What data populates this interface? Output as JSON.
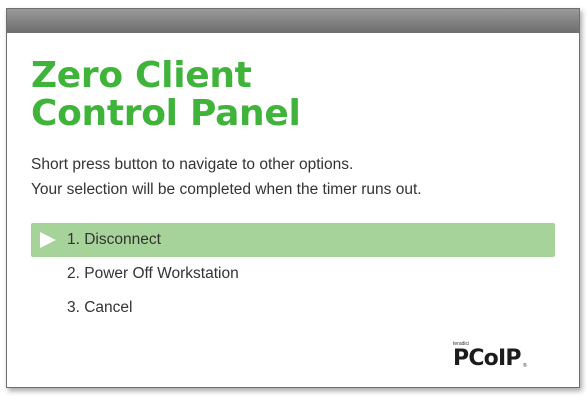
{
  "panel": {
    "title_line1": "Zero Client",
    "title_line2": "Control Panel",
    "instruction_line1": "Short press button to navigate to other options.",
    "instruction_line2": "Your selection will be completed when the timer runs out."
  },
  "menu": {
    "items": [
      {
        "label": "1. Disconnect",
        "selected": true
      },
      {
        "label": "2. Power Off Workstation",
        "selected": false
      },
      {
        "label": "3. Cancel",
        "selected": false
      }
    ],
    "selection_icon": "play-arrow-icon"
  },
  "logo": {
    "brand": "teradici",
    "text": "PCoIP",
    "registered": "®"
  },
  "colors": {
    "title": "#40b33b",
    "selected_row": "#a6d39a",
    "text": "#333333",
    "title_strip": "#7a7a7a"
  }
}
